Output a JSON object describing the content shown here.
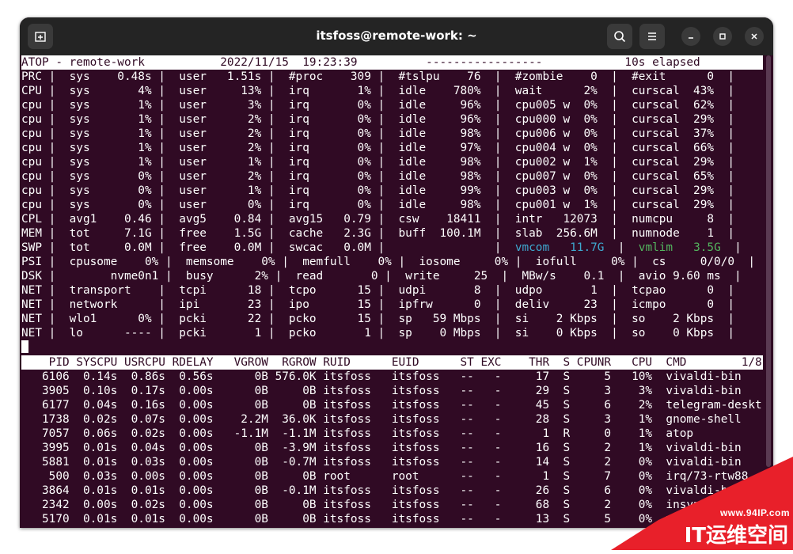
{
  "window": {
    "title": "itsfoss@remote-work: ~"
  },
  "titlebar": {
    "new_tab_icon": "new-tab-icon",
    "search_icon": "search-icon",
    "menu_icon": "hamburger-menu-icon",
    "minimize_icon": "minimize-icon",
    "maximize_icon": "maximize-icon",
    "close_icon": "close-icon"
  },
  "header": {
    "line": "ATOP - remote-work           2022/11/15  19:23:39          -----------------            10s elapsed"
  },
  "system_lines": [
    "PRC |  sys    0.48s |  user   1.51s |  #proc    309 |  #tslpu    76  |  #zombie    0  |  #exit      0  |",
    "CPU |  sys       4% |  user     13% |  irq       1% |  idle    780%  |  wait      2%  |  curscal  43%  |",
    "cpu |  sys       1% |  user      3% |  irq       0% |  idle     96%  |  cpu005 w  0%  |  curscal  62%  |",
    "cpu |  sys       1% |  user      2% |  irq       0% |  idle     96%  |  cpu000 w  0%  |  curscal  29%  |",
    "cpu |  sys       1% |  user      2% |  irq       0% |  idle     98%  |  cpu006 w  0%  |  curscal  37%  |",
    "cpu |  sys       1% |  user      2% |  irq       0% |  idle     97%  |  cpu004 w  0%  |  curscal  66%  |",
    "cpu |  sys       1% |  user      1% |  irq       0% |  idle     98%  |  cpu002 w  1%  |  curscal  29%  |",
    "cpu |  sys       0% |  user      2% |  irq       0% |  idle     98%  |  cpu007 w  0%  |  curscal  65%  |",
    "cpu |  sys       0% |  user      1% |  irq       0% |  idle     99%  |  cpu003 w  0%  |  curscal  29%  |",
    "cpu |  sys       0% |  user      0% |  irq       0% |  idle     98%  |  cpu001 w  1%  |  curscal  29%  |",
    "CPL |  avg1    0.46 |  avg5    0.84 |  avg15   0.79 |  csw    18411  |  intr   12073  |  numcpu     8  |",
    "MEM |  tot     7.1G |  free    1.5G |  cache   2.3G |  buff  100.1M  |  slab  256.6M  |  numnode    1  |"
  ],
  "swp_line": {
    "start": "SWP |  tot     0.0M |  free    0.0M |  swcac   0.0M |                |  ",
    "vmcom": "vmcom   11.7G",
    "mid": "  |  ",
    "vmlim": "vmlim   3.5G",
    "end": "  |"
  },
  "system_lines_2": [
    "PSI |  cpusome    0% |  memsome    0% |  memfull    0% |  iosome     0% |  iofull     0% |  cs     0/0/0  |",
    "DSK |        nvme0n1 |  busy      2% |  read       0 |  write     25  |  MBw/s    0.1  |  avio 9.60 ms  |",
    "NET |  transport    |  tcpi      18 |  tcpo      15 |  udpi       8  |  udpo       1  |  tcpao      0  |",
    "NET |  network      |  ipi       23 |  ipo       15 |  ipfrw      0  |  deliv     23  |  icmpo      0  |",
    "NET |  wlo1      0% |  pcki      22 |  pcko      15 |  sp   59 Mbps  |  si    2 Kbps  |  so    2 Kbps  |",
    "NET |  lo      ---- |  pcki       1 |  pcko       1 |  sp    0 Mbps  |  si    0 Kbps  |  so    0 Kbps  |"
  ],
  "process_header": "    PID SYSCPU USRCPU RDELAY   VGROW  RGROW RUID      EUID      ST EXC    THR  S CPUNR   CPU  CMD        1/8",
  "process_rows": [
    "   6106  0.14s  0.86s  0.56s      0B 576.0K itsfoss   itsfoss   --   -     17  S     5   10%  vivaldi-bin",
    "   3905  0.10s  0.17s  0.00s      0B     0B itsfoss   itsfoss   --   -     29  S     3    3%  vivaldi-bin",
    "   6177  0.04s  0.16s  0.00s      0B     0B itsfoss   itsfoss   --   -     45  S     6    2%  telegram-deskt",
    "   1738  0.02s  0.07s  0.00s    2.2M  36.0K itsfoss   itsfoss   --   -     28  S     3    1%  gnome-shell",
    "   7057  0.06s  0.02s  0.00s   -1.1M  -1.1M itsfoss   itsfoss   --   -      1  R     0    1%  atop",
    "   3995  0.01s  0.04s  0.00s      0B  -3.9M itsfoss   itsfoss   --   -     16  S     2    1%  vivaldi-bin",
    "   5881  0.01s  0.03s  0.00s      0B  -0.7M itsfoss   itsfoss   --   -     14  S     2    0%  vivaldi-bin",
    "    500  0.03s  0.00s  0.00s      0B     0B root      root      --   -      1  S     7    0%  irq/73-rtw88",
    "   3864  0.01s  0.01s  0.00s      0B  -0.1M itsfoss   itsfoss   --   -     26  S     6    0%  vivaldi-b",
    "   2342  0.00s  0.02s  0.00s      0B     0B itsfoss   itsfoss   --   -     68  S     2    0%  insyn",
    "   5170  0.01s  0.01s  0.00s      0B     0B itsfoss   itsfoss   --   -     13  S     5    0%  vi"
  ],
  "watermark": {
    "url": "www.94IP.com",
    "brand": "IT运维空间"
  }
}
